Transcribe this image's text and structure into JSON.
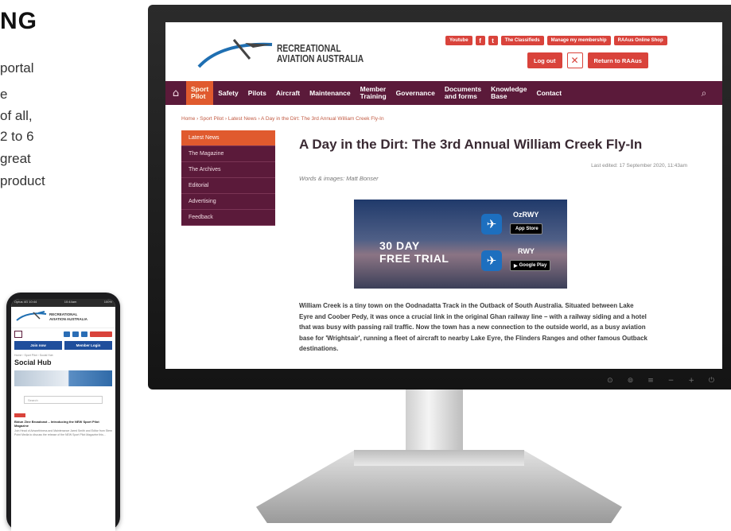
{
  "promo": {
    "heading_fragment": "NG",
    "lines": [
      "portal",
      "e",
      "of all,",
      "2 to 6",
      "great",
      "product"
    ]
  },
  "phone": {
    "status_left": "Optus 4G 10:44",
    "status_center": "10:44am",
    "status_right": "100%",
    "logo_line1": "RECREATIONAL",
    "logo_line2": "AVIATION AUSTRALIA",
    "join_label": "Join now",
    "login_label": "Member Login",
    "breadcrumb": "Home › Sport Pilot › Social Hub",
    "page_title": "Social Hub",
    "search_placeholder": "Search",
    "article_title": "Bidun Zine Broadcast – Introducing the NEW Sport Pilot Magazine",
    "article_text": "Join Head of Airworthiness and Maintenance Jared Smith and Editor from Stem Point Media to discuss the release of the NEW Sport Pilot Magazine this..."
  },
  "site": {
    "logo_line1": "RECREATIONAL",
    "logo_line2": "AVIATION AUSTRALIA",
    "top_links": [
      "Youtube",
      "f",
      "t",
      "The Classifieds",
      "Manage my membership",
      "RAAus Online Shop"
    ],
    "logout_label": "Log out",
    "close_glyph": "✕",
    "return_label": "Return to RAAus",
    "nav": {
      "home_glyph": "⌂",
      "items": [
        "Sport\nPilot",
        "Safety",
        "Pilots",
        "Aircraft",
        "Maintenance",
        "Member\nTraining",
        "Governance",
        "Documents\nand forms",
        "Knowledge\nBase",
        "Contact"
      ],
      "search_glyph": "⌕"
    },
    "breadcrumb": "Home › Sport Pilot › Latest News › A Day in the Dirt: The 3rd Annual William Creek Fly-In",
    "side_menu": [
      "Latest News",
      "The Magazine",
      "The Archives",
      "Editorial",
      "Advertising",
      "Feedback"
    ],
    "article": {
      "title": "A Day in the Dirt: The 3rd Annual William Creek Fly-In",
      "last_edited": "Last edited: 17 September 2020, 11:43am",
      "byline": "Words & images: Matt Bonser",
      "ad": {
        "trial_line1": "30 DAY",
        "trial_line2": "FREE TRIAL",
        "app1_name": "OzRWY",
        "app1_store": "App Store",
        "app2_name": "RWY",
        "app2_store": "Google Play"
      },
      "body": "William Creek is a tiny town on the Oodnadatta Track in the Outback of South Australia. Situated between Lake Eyre and Coober Pedy, it was once a crucial link in the original Ghan railway line – with a railway siding and a hotel that was busy with passing rail traffic. Now the town has a new connection to the outside world, as a busy aviation base for 'Wrightsair', running a fleet of aircraft to nearby Lake Eyre, the Flinders Ranges and other famous Outback destinations."
    }
  },
  "monitor": {
    "controls": [
      "⊙",
      "⊚",
      "≡",
      "−",
      "+",
      "⏻"
    ]
  }
}
